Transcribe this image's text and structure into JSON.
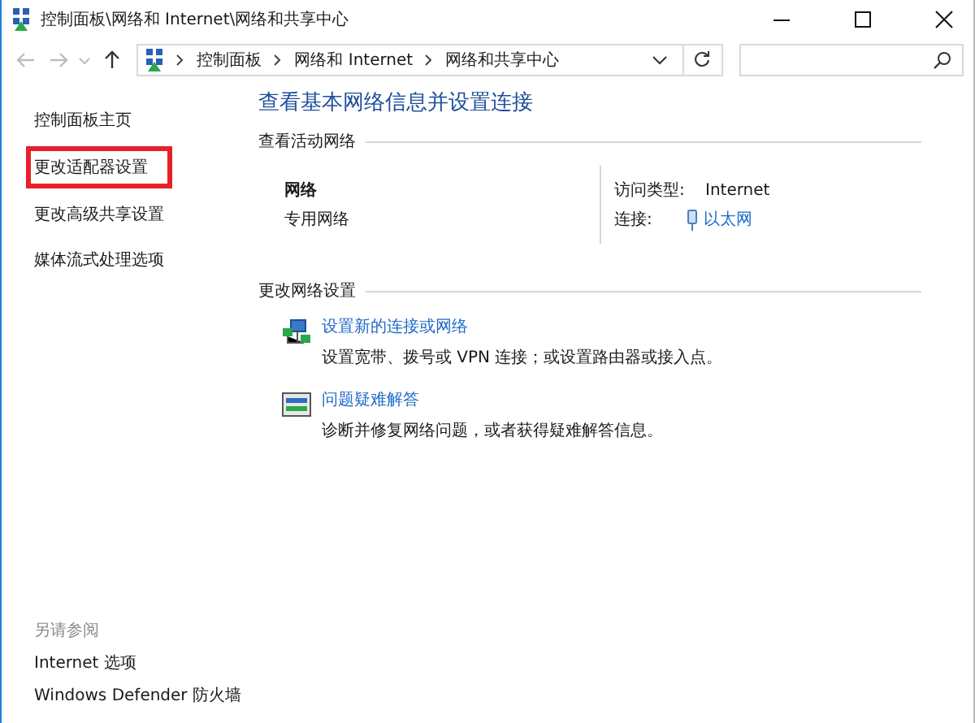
{
  "window": {
    "title": "控制面板\\网络和 Internet\\网络和共享中心"
  },
  "navigation": {
    "back": {
      "disabled": true
    },
    "forward": {
      "disabled": true
    }
  },
  "address_bar": {
    "crumbs": [
      "控制面板",
      "网络和 Internet",
      "网络和共享中心"
    ]
  },
  "sidebar": {
    "items": [
      {
        "label": "控制面板主页",
        "highlighted": false
      },
      {
        "label": "更改适配器设置",
        "highlighted": true
      },
      {
        "label": "更改高级共享设置",
        "highlighted": false
      },
      {
        "label": "媒体流式处理选项",
        "highlighted": false
      }
    ],
    "see_also": {
      "heading": "另请参阅",
      "links": [
        "Internet 选项",
        "Windows Defender 防火墙"
      ]
    }
  },
  "main": {
    "heading": "查看基本网络信息并设置连接",
    "active_networks": {
      "section": "查看活动网络",
      "network_name": "网络",
      "network_type": "专用网络",
      "access_type_label": "访问类型:",
      "access_type_value": "Internet",
      "connection_label": "连接:",
      "connection_value": "以太网"
    },
    "change_settings": {
      "section": "更改网络设置",
      "tasks": [
        {
          "kind": "new-connection",
          "link": "设置新的连接或网络",
          "description": "设置宽带、拨号或 VPN 连接；或设置路由器或接入点。"
        },
        {
          "kind": "troubleshoot",
          "link": "问题疑难解答",
          "description": "诊断并修复网络问题，或者获得疑难解答信息。"
        }
      ]
    }
  }
}
